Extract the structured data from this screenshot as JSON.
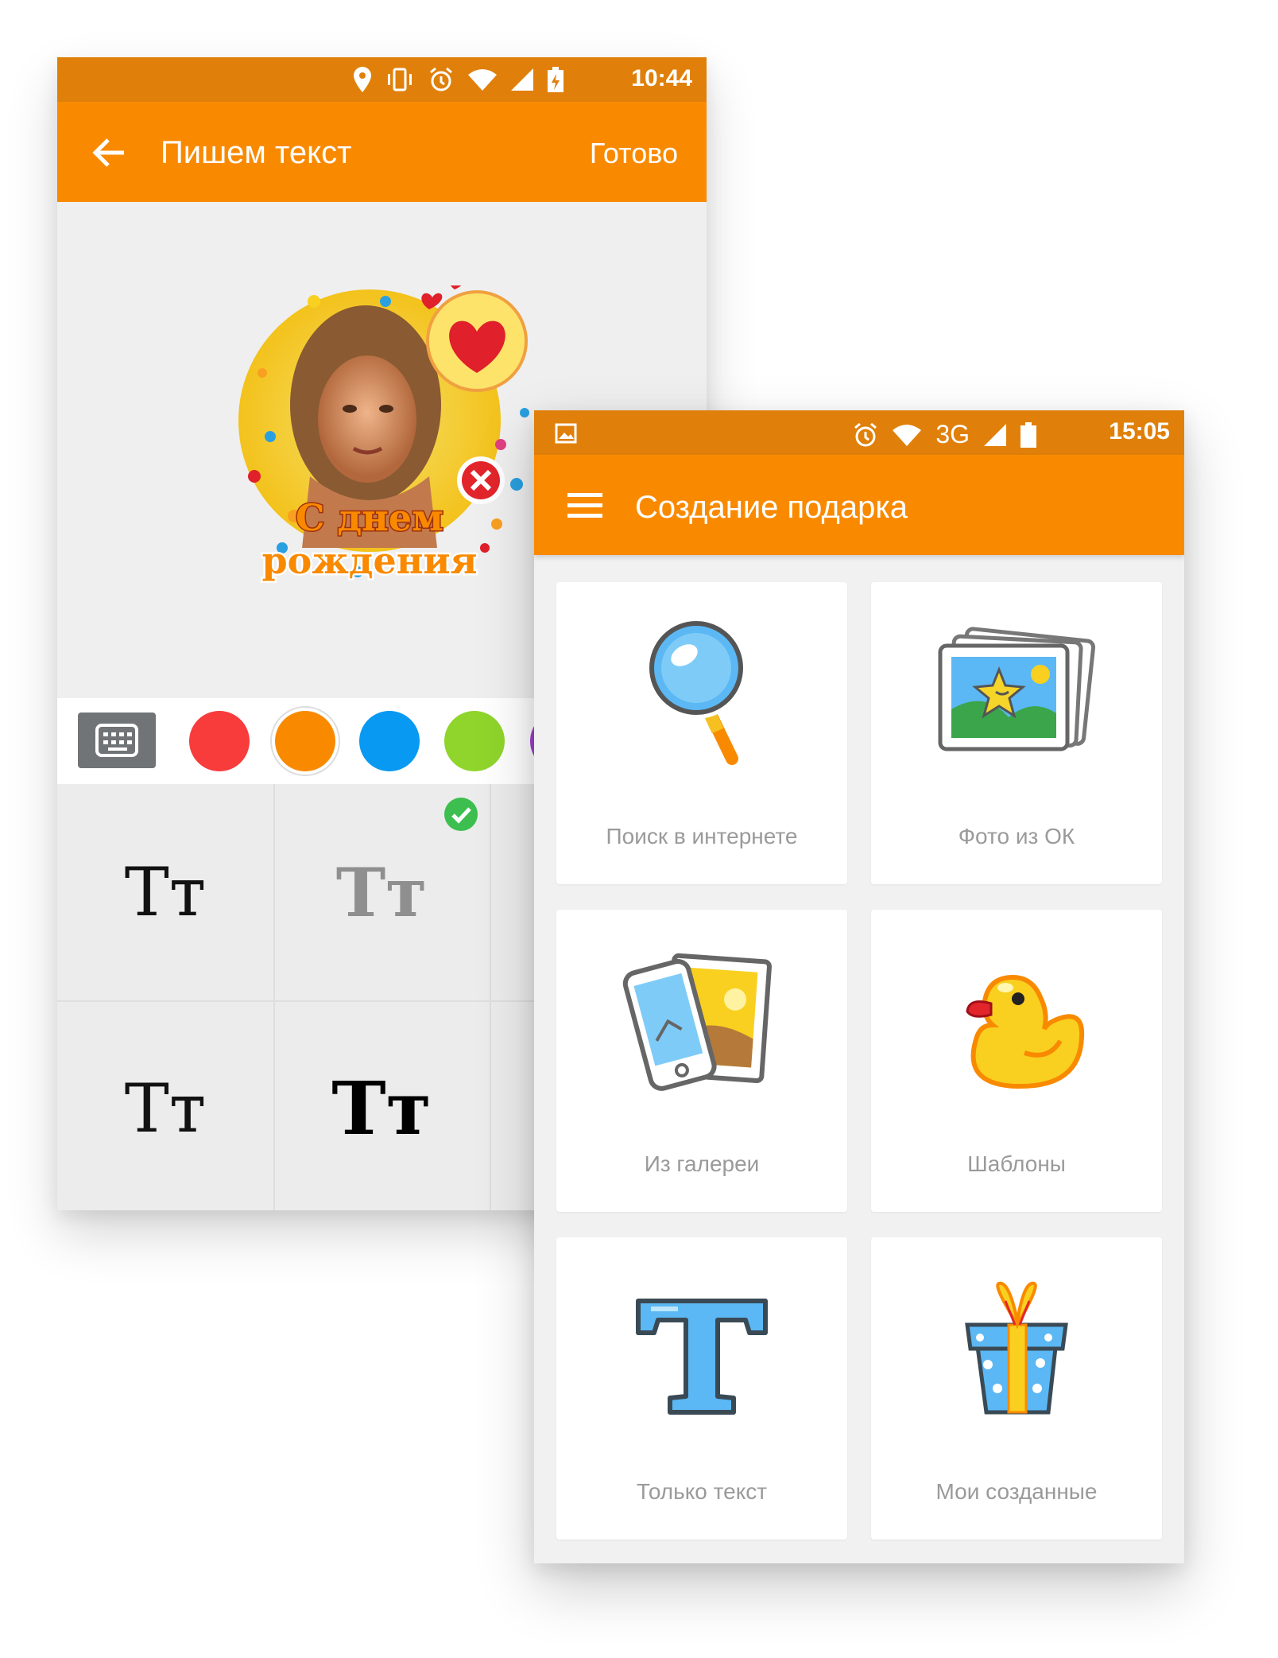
{
  "phone_a": {
    "status": {
      "time": "10:44"
    },
    "appbar": {
      "title": "Пишем текст",
      "done": "Готово"
    },
    "sticker": {
      "line1": "С днем",
      "line2": "рождения"
    },
    "swatches": [
      "#f83b3b",
      "#f98a00",
      "#0899f2",
      "#8fd52b",
      "#a040d0"
    ],
    "fonts": [
      {
        "label": "Tт",
        "style": "serif",
        "selected": false
      },
      {
        "label": "Tт",
        "style": "slab-light",
        "selected": true
      },
      {
        "label": "Tт",
        "style": "serif",
        "selected": false
      },
      {
        "label": "Tт",
        "style": "slab-bold",
        "selected": false
      }
    ]
  },
  "phone_b": {
    "status": {
      "network": "3G",
      "time": "15:05"
    },
    "appbar": {
      "title": "Создание подарка"
    },
    "tiles": [
      {
        "label": "Поиск в интернете",
        "icon": "magnifier-icon"
      },
      {
        "label": "Фото из ОК",
        "icon": "photos-icon"
      },
      {
        "label": "Из галереи",
        "icon": "gallery-phone-icon"
      },
      {
        "label": "Шаблоны",
        "icon": "duck-icon"
      },
      {
        "label": "Только текст",
        "icon": "text-t-icon"
      },
      {
        "label": "Мои созданные",
        "icon": "gift-icon"
      }
    ]
  }
}
